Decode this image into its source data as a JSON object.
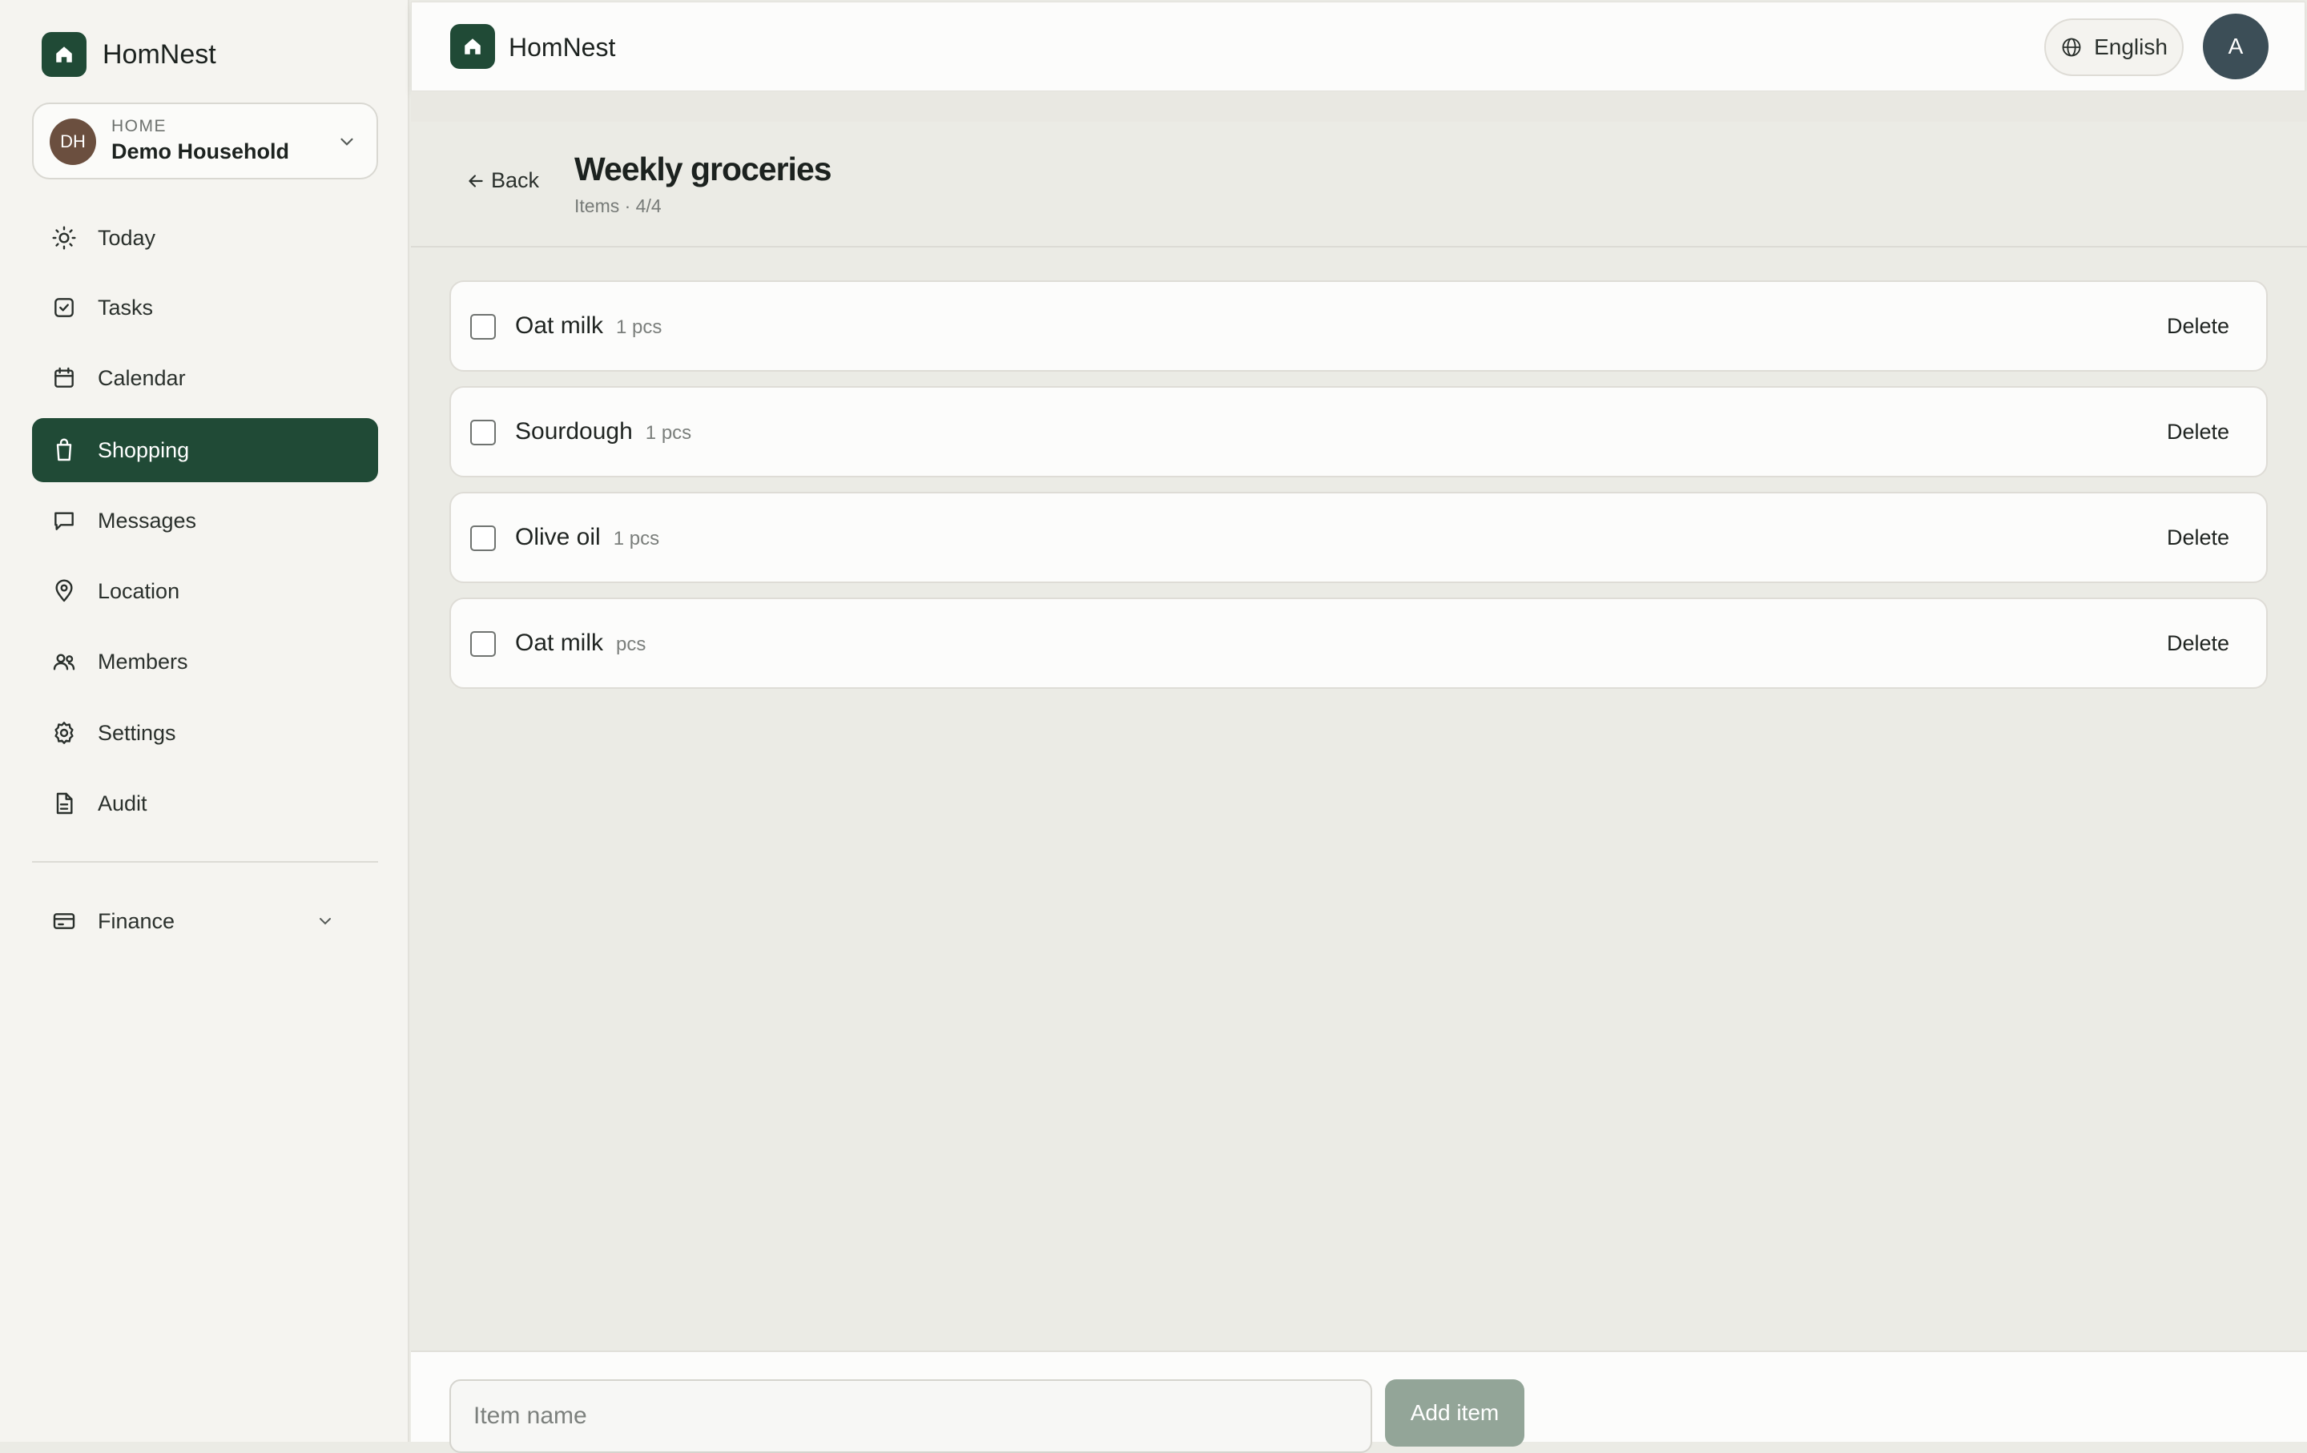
{
  "app": {
    "name": "HomNest"
  },
  "household": {
    "label": "HOME",
    "name": "Demo Household",
    "initials": "DH"
  },
  "nav": {
    "items": [
      {
        "label": "Today",
        "icon": "sun-icon"
      },
      {
        "label": "Tasks",
        "icon": "check-square-icon"
      },
      {
        "label": "Calendar",
        "icon": "calendar-icon"
      },
      {
        "label": "Shopping",
        "icon": "shopping-bag-icon",
        "active": true
      },
      {
        "label": "Messages",
        "icon": "message-icon"
      },
      {
        "label": "Location",
        "icon": "map-pin-icon"
      },
      {
        "label": "Members",
        "icon": "users-icon"
      },
      {
        "label": "Settings",
        "icon": "gear-icon"
      },
      {
        "label": "Audit",
        "icon": "document-icon"
      }
    ],
    "finance": {
      "label": "Finance",
      "icon": "credit-card-icon"
    }
  },
  "header": {
    "app_name": "HomNest",
    "language": "English",
    "user_initial": "A"
  },
  "list": {
    "back_label": "Back",
    "title": "Weekly groceries",
    "subtitle": "Items · 4/4",
    "items": [
      {
        "name": "Oat milk",
        "qty": "1 pcs",
        "action": "Delete",
        "checked": false
      },
      {
        "name": "Sourdough",
        "qty": "1 pcs",
        "action": "Delete",
        "checked": false
      },
      {
        "name": "Olive oil",
        "qty": "1 pcs",
        "action": "Delete",
        "checked": false
      },
      {
        "name": "Oat milk",
        "qty": "pcs",
        "action": "Delete",
        "checked": false
      }
    ]
  },
  "composer": {
    "placeholder": "Item name",
    "add_label": "Add item"
  },
  "colors": {
    "accent": "#204a36",
    "add_button": "#93a598",
    "avatar_user": "#3c4e57",
    "avatar_household": "#6b4f3f"
  }
}
